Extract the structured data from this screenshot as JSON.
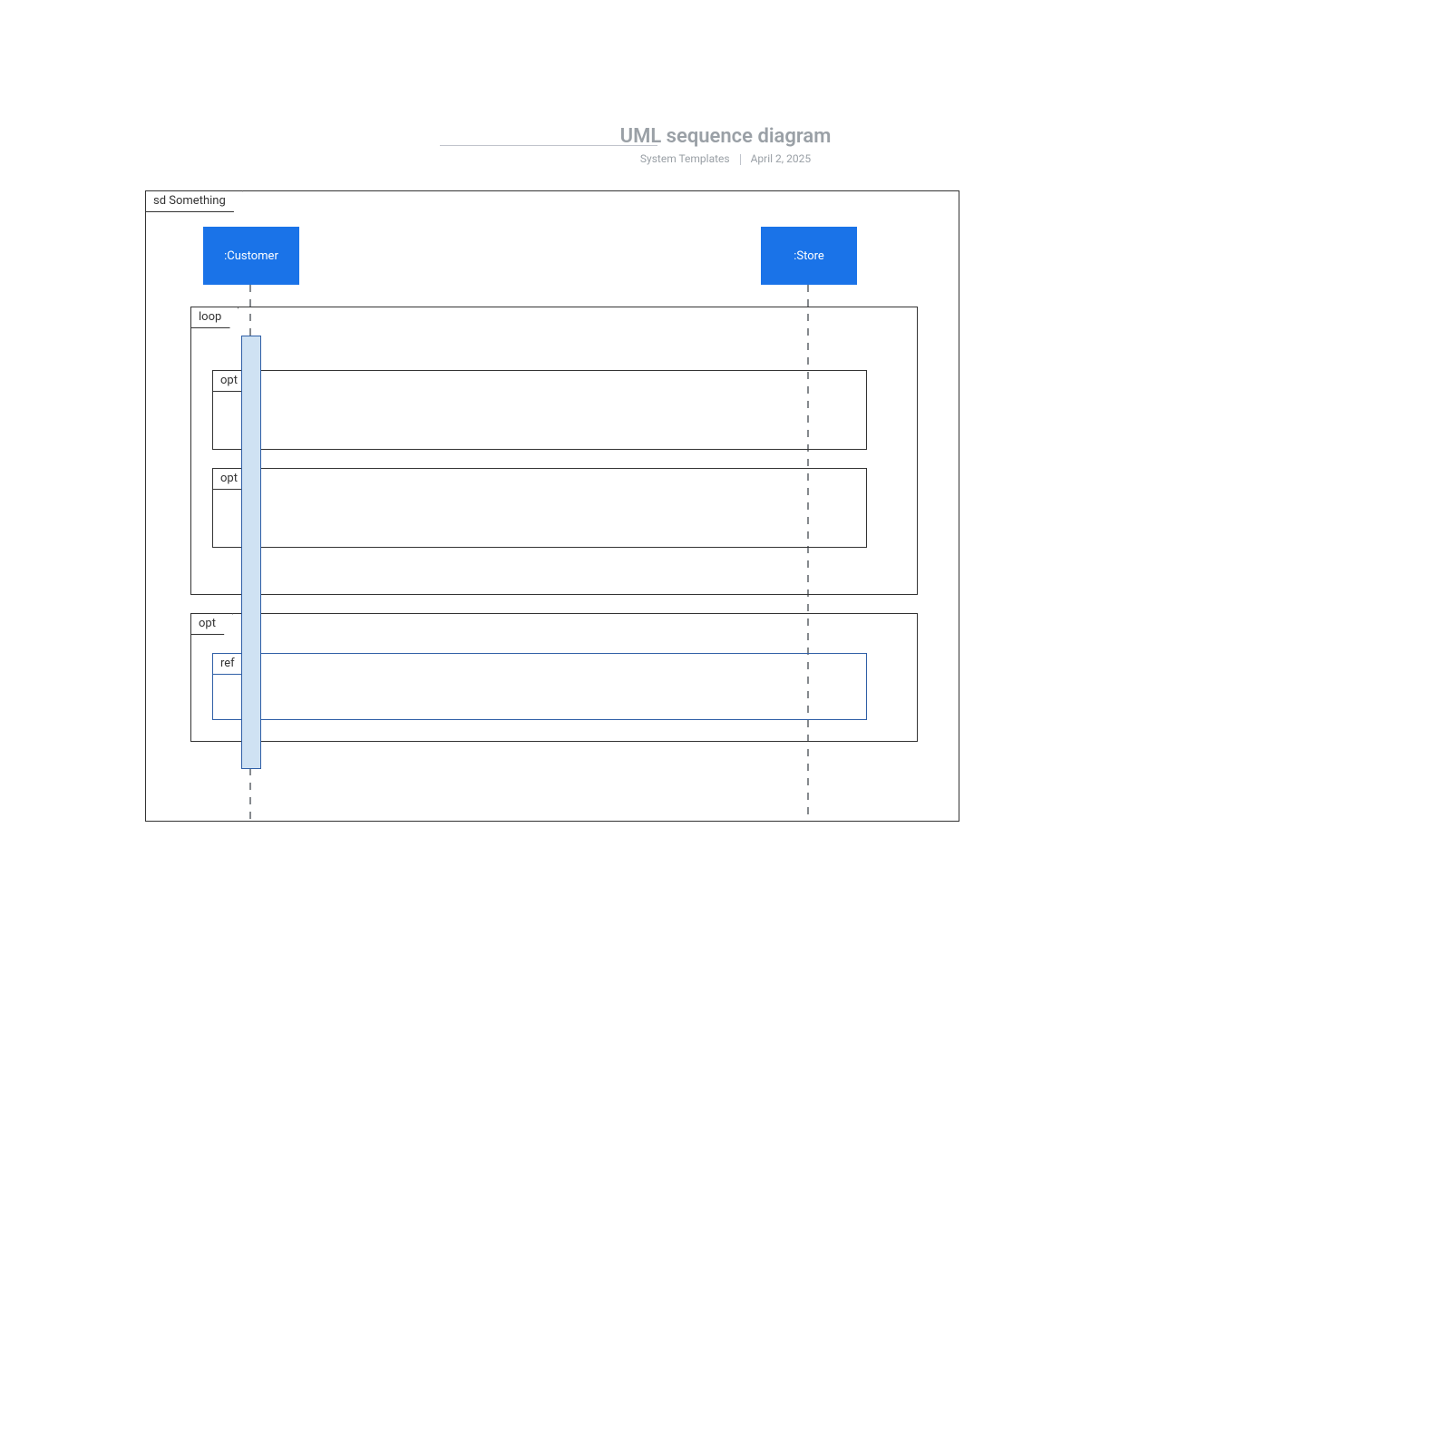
{
  "header": {
    "title": "UML sequence diagram",
    "subtitle_left": "System Templates",
    "subtitle_right": "April 2, 2025"
  },
  "frame": {
    "label": "sd Something"
  },
  "lifelines": {
    "customer": ":Customer",
    "store": ":Store"
  },
  "fragments": {
    "loop": "loop",
    "opt1": "opt",
    "opt2": "opt",
    "opt3": "opt",
    "ref": "ref"
  },
  "colors": {
    "accent": "#1a73e8",
    "outline": "#333333",
    "blue_outline": "#2f5fa6",
    "activation_fill": "#cfe2f3",
    "muted_text": "#9aa0a6"
  }
}
